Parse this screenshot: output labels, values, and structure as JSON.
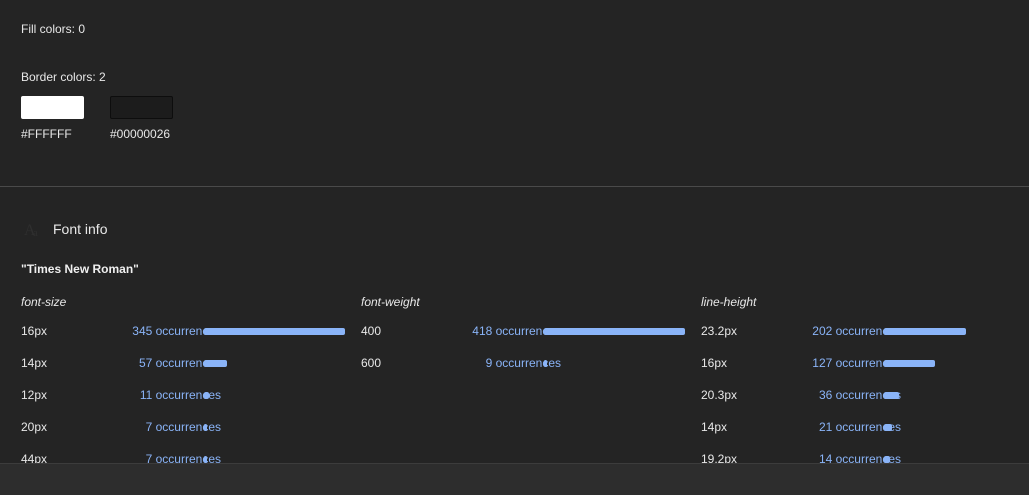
{
  "fill_colors_label": "Fill colors: 0",
  "border_colors_label": "Border colors: 2",
  "border_colors": [
    {
      "hex": "#FFFFFF",
      "swatch": "#FFFFFF"
    },
    {
      "hex": "#00000026",
      "swatch": "#1c1c1c"
    }
  ],
  "font_info": {
    "title": "Font info",
    "family": "\"Times New Roman\"",
    "columns": {
      "size": {
        "title": "font-size",
        "rows": [
          {
            "value": "16px",
            "count": "345 occurrences",
            "fraction": 1.0
          },
          {
            "value": "14px",
            "count": "57 occurrences",
            "fraction": 0.165
          },
          {
            "value": "12px",
            "count": "11 occurrences",
            "fraction": 0.032
          },
          {
            "value": "20px",
            "count": "7 occurrences",
            "fraction": 0.02
          },
          {
            "value": "44px",
            "count": "7 occurrences",
            "fraction": 0.02
          }
        ]
      },
      "weight": {
        "title": "font-weight",
        "rows": [
          {
            "value": "400",
            "count": "418 occurrences",
            "fraction": 1.0
          },
          {
            "value": "600",
            "count": "9 occurrences",
            "fraction": 0.022
          }
        ]
      },
      "line": {
        "title": "line-height",
        "rows": [
          {
            "value": "23.2px",
            "count": "202 occurrences",
            "fraction": 0.58
          },
          {
            "value": "16px",
            "count": "127 occurrences",
            "fraction": 0.365
          },
          {
            "value": "20.3px",
            "count": "36 occurrences",
            "fraction": 0.103
          },
          {
            "value": "14px",
            "count": "21 occurrences",
            "fraction": 0.06
          },
          {
            "value": "19.2px",
            "count": "14 occurrences",
            "fraction": 0.04
          }
        ]
      }
    }
  },
  "accent_color": "#8ab4f8"
}
